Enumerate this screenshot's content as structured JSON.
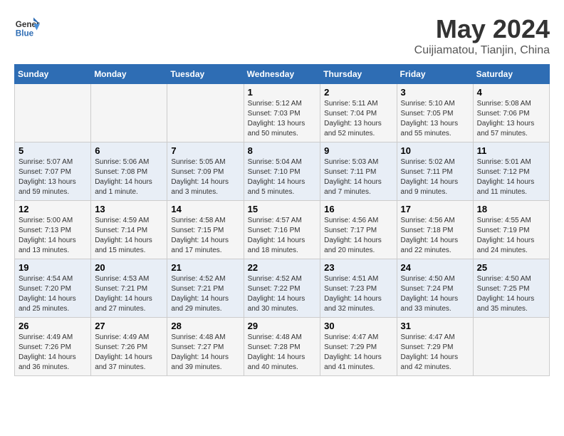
{
  "header": {
    "logo_line1": "General",
    "logo_line2": "Blue",
    "title": "May 2024",
    "subtitle": "Cuijiamatou, Tianjin, China"
  },
  "days_of_week": [
    "Sunday",
    "Monday",
    "Tuesday",
    "Wednesday",
    "Thursday",
    "Friday",
    "Saturday"
  ],
  "weeks": [
    [
      {
        "day": "",
        "info": ""
      },
      {
        "day": "",
        "info": ""
      },
      {
        "day": "",
        "info": ""
      },
      {
        "day": "1",
        "info": "Sunrise: 5:12 AM\nSunset: 7:03 PM\nDaylight: 13 hours\nand 50 minutes."
      },
      {
        "day": "2",
        "info": "Sunrise: 5:11 AM\nSunset: 7:04 PM\nDaylight: 13 hours\nand 52 minutes."
      },
      {
        "day": "3",
        "info": "Sunrise: 5:10 AM\nSunset: 7:05 PM\nDaylight: 13 hours\nand 55 minutes."
      },
      {
        "day": "4",
        "info": "Sunrise: 5:08 AM\nSunset: 7:06 PM\nDaylight: 13 hours\nand 57 minutes."
      }
    ],
    [
      {
        "day": "5",
        "info": "Sunrise: 5:07 AM\nSunset: 7:07 PM\nDaylight: 13 hours\nand 59 minutes."
      },
      {
        "day": "6",
        "info": "Sunrise: 5:06 AM\nSunset: 7:08 PM\nDaylight: 14 hours\nand 1 minute."
      },
      {
        "day": "7",
        "info": "Sunrise: 5:05 AM\nSunset: 7:09 PM\nDaylight: 14 hours\nand 3 minutes."
      },
      {
        "day": "8",
        "info": "Sunrise: 5:04 AM\nSunset: 7:10 PM\nDaylight: 14 hours\nand 5 minutes."
      },
      {
        "day": "9",
        "info": "Sunrise: 5:03 AM\nSunset: 7:11 PM\nDaylight: 14 hours\nand 7 minutes."
      },
      {
        "day": "10",
        "info": "Sunrise: 5:02 AM\nSunset: 7:11 PM\nDaylight: 14 hours\nand 9 minutes."
      },
      {
        "day": "11",
        "info": "Sunrise: 5:01 AM\nSunset: 7:12 PM\nDaylight: 14 hours\nand 11 minutes."
      }
    ],
    [
      {
        "day": "12",
        "info": "Sunrise: 5:00 AM\nSunset: 7:13 PM\nDaylight: 14 hours\nand 13 minutes."
      },
      {
        "day": "13",
        "info": "Sunrise: 4:59 AM\nSunset: 7:14 PM\nDaylight: 14 hours\nand 15 minutes."
      },
      {
        "day": "14",
        "info": "Sunrise: 4:58 AM\nSunset: 7:15 PM\nDaylight: 14 hours\nand 17 minutes."
      },
      {
        "day": "15",
        "info": "Sunrise: 4:57 AM\nSunset: 7:16 PM\nDaylight: 14 hours\nand 18 minutes."
      },
      {
        "day": "16",
        "info": "Sunrise: 4:56 AM\nSunset: 7:17 PM\nDaylight: 14 hours\nand 20 minutes."
      },
      {
        "day": "17",
        "info": "Sunrise: 4:56 AM\nSunset: 7:18 PM\nDaylight: 14 hours\nand 22 minutes."
      },
      {
        "day": "18",
        "info": "Sunrise: 4:55 AM\nSunset: 7:19 PM\nDaylight: 14 hours\nand 24 minutes."
      }
    ],
    [
      {
        "day": "19",
        "info": "Sunrise: 4:54 AM\nSunset: 7:20 PM\nDaylight: 14 hours\nand 25 minutes."
      },
      {
        "day": "20",
        "info": "Sunrise: 4:53 AM\nSunset: 7:21 PM\nDaylight: 14 hours\nand 27 minutes."
      },
      {
        "day": "21",
        "info": "Sunrise: 4:52 AM\nSunset: 7:21 PM\nDaylight: 14 hours\nand 29 minutes."
      },
      {
        "day": "22",
        "info": "Sunrise: 4:52 AM\nSunset: 7:22 PM\nDaylight: 14 hours\nand 30 minutes."
      },
      {
        "day": "23",
        "info": "Sunrise: 4:51 AM\nSunset: 7:23 PM\nDaylight: 14 hours\nand 32 minutes."
      },
      {
        "day": "24",
        "info": "Sunrise: 4:50 AM\nSunset: 7:24 PM\nDaylight: 14 hours\nand 33 minutes."
      },
      {
        "day": "25",
        "info": "Sunrise: 4:50 AM\nSunset: 7:25 PM\nDaylight: 14 hours\nand 35 minutes."
      }
    ],
    [
      {
        "day": "26",
        "info": "Sunrise: 4:49 AM\nSunset: 7:26 PM\nDaylight: 14 hours\nand 36 minutes."
      },
      {
        "day": "27",
        "info": "Sunrise: 4:49 AM\nSunset: 7:26 PM\nDaylight: 14 hours\nand 37 minutes."
      },
      {
        "day": "28",
        "info": "Sunrise: 4:48 AM\nSunset: 7:27 PM\nDaylight: 14 hours\nand 39 minutes."
      },
      {
        "day": "29",
        "info": "Sunrise: 4:48 AM\nSunset: 7:28 PM\nDaylight: 14 hours\nand 40 minutes."
      },
      {
        "day": "30",
        "info": "Sunrise: 4:47 AM\nSunset: 7:29 PM\nDaylight: 14 hours\nand 41 minutes."
      },
      {
        "day": "31",
        "info": "Sunrise: 4:47 AM\nSunset: 7:29 PM\nDaylight: 14 hours\nand 42 minutes."
      },
      {
        "day": "",
        "info": ""
      }
    ]
  ],
  "colors": {
    "header_bg": "#2e6db4",
    "row_odd": "#f5f5f5",
    "row_even": "#e8eef6"
  }
}
